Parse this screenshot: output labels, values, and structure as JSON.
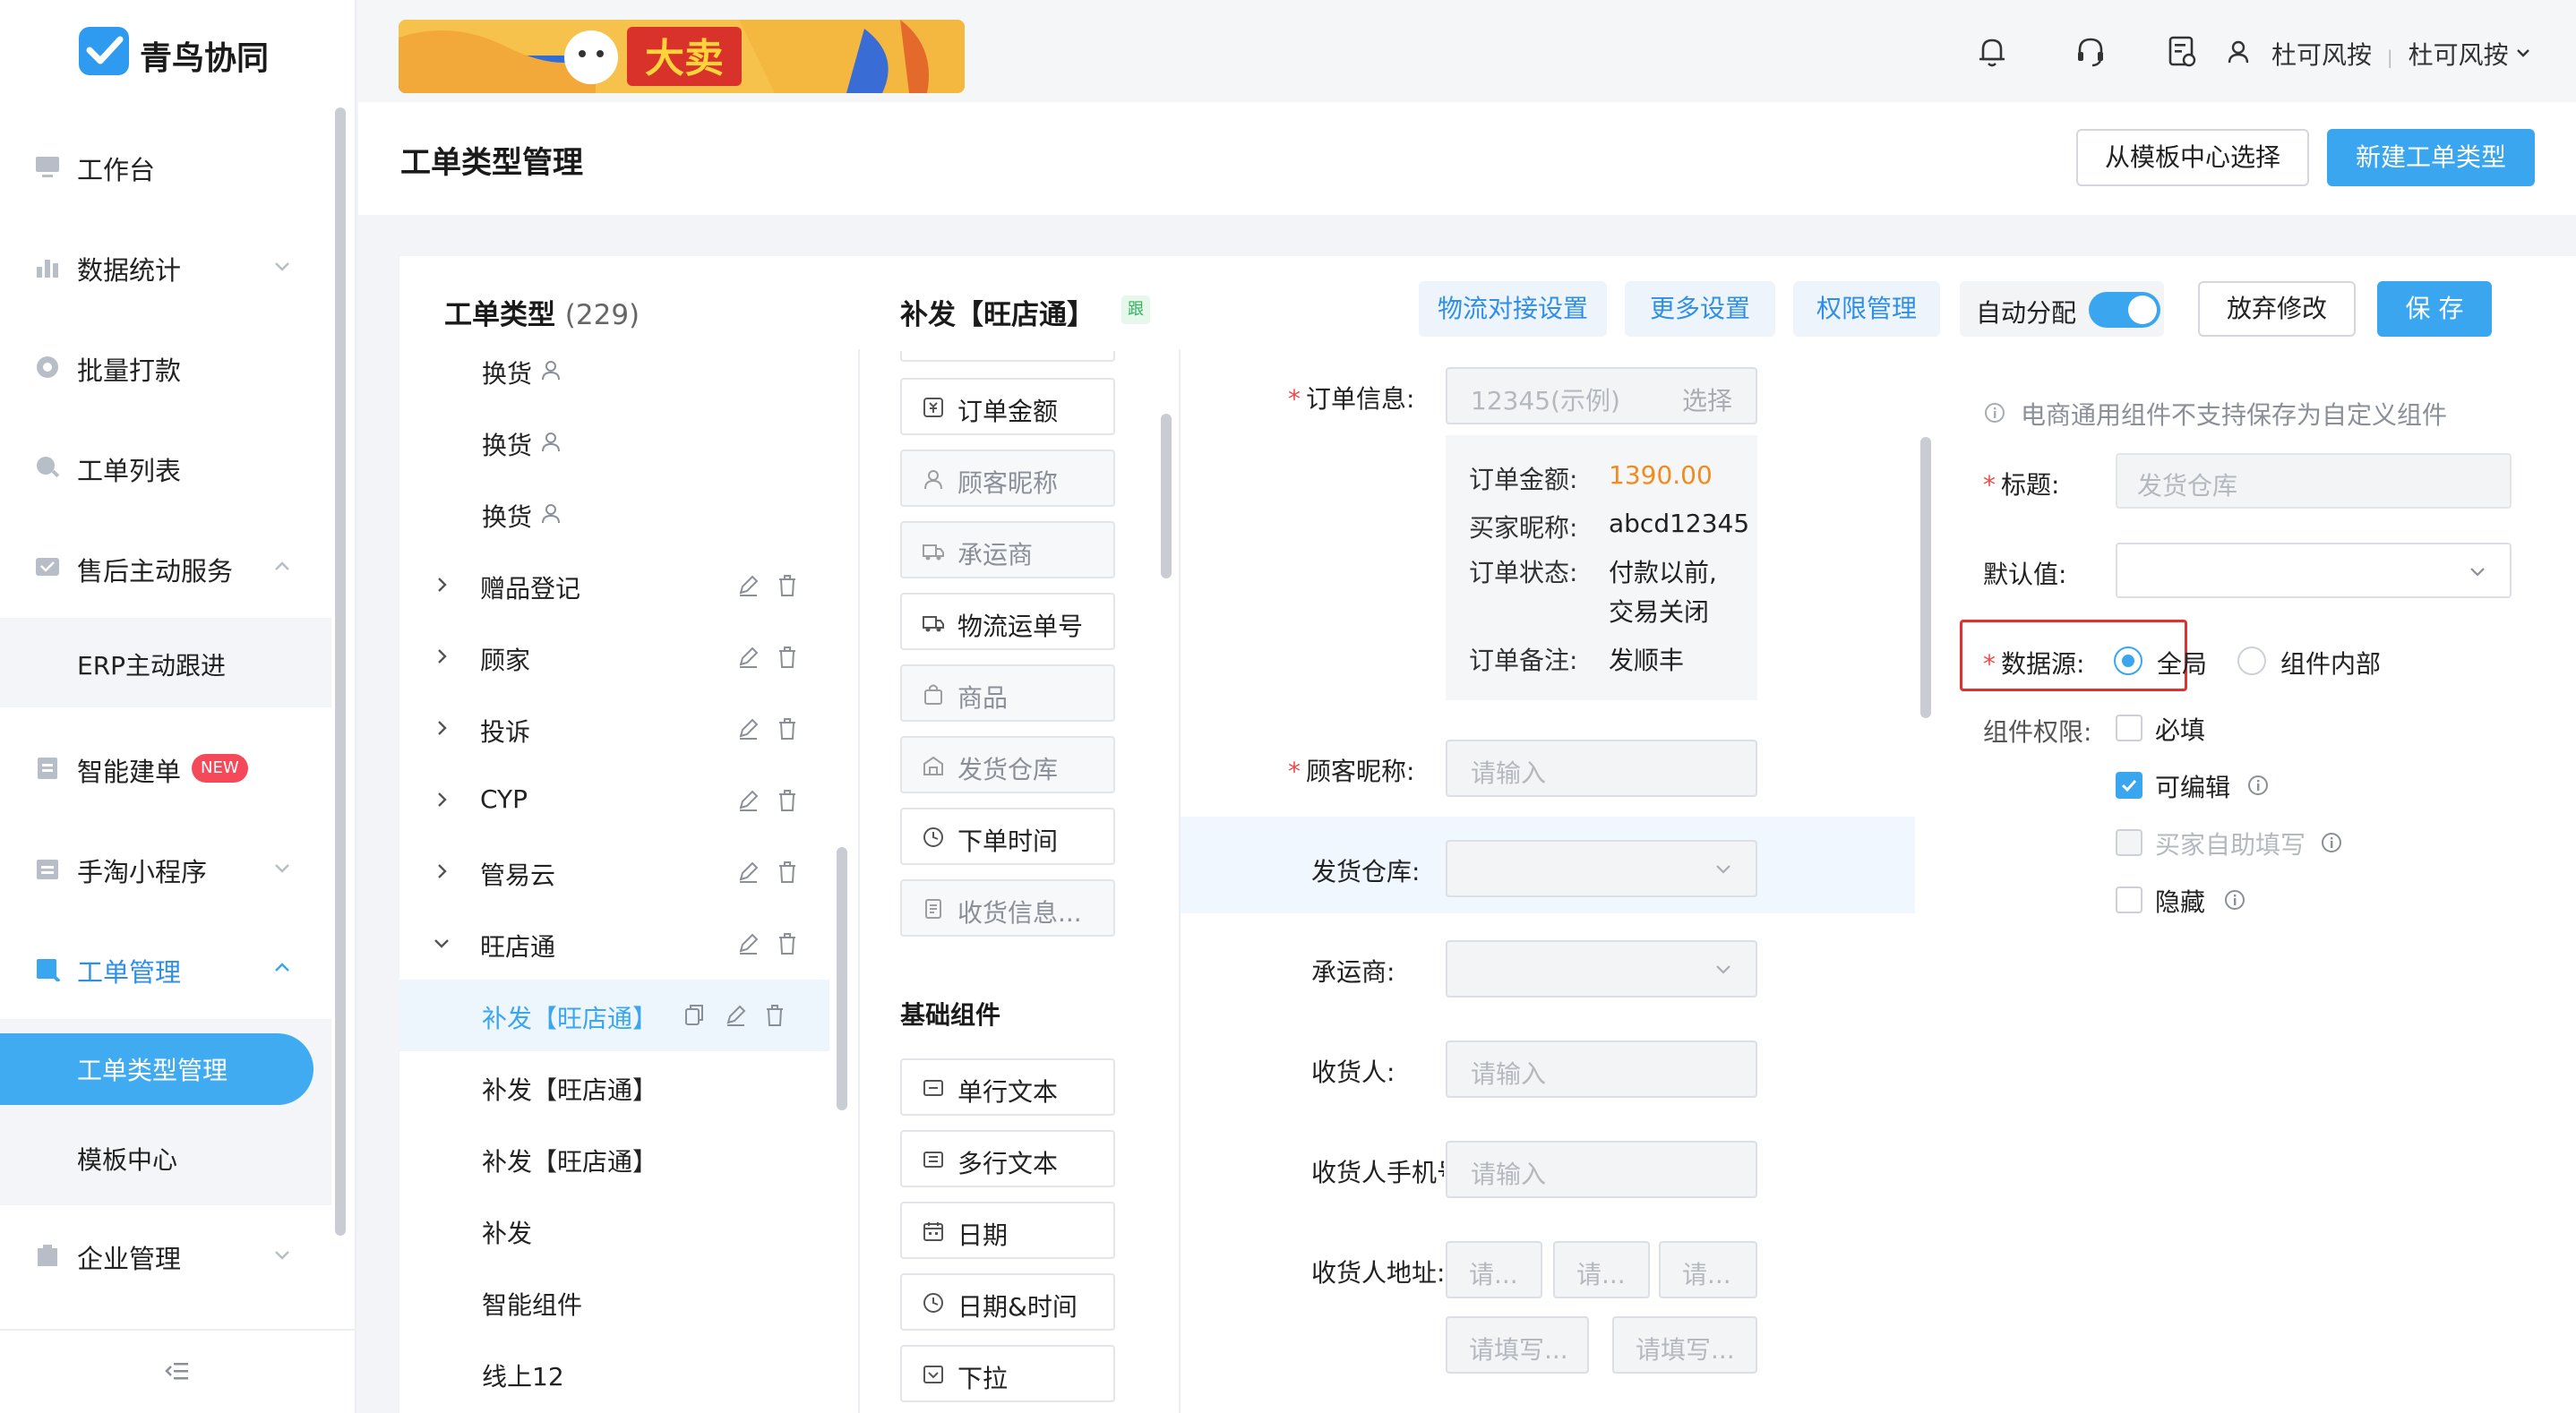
{
  "app": {
    "name": "青鸟协同"
  },
  "sidebar": {
    "items": [
      {
        "label": "工作台"
      },
      {
        "label": "数据统计"
      },
      {
        "label": "批量打款"
      },
      {
        "label": "工单列表"
      },
      {
        "label": "售后主动服务"
      },
      {
        "label": "ERP主动跟进"
      },
      {
        "label": "智能建单",
        "badge": "NEW"
      },
      {
        "label": "手淘小程序"
      },
      {
        "label": "工单管理"
      },
      {
        "label": "工单类型管理"
      },
      {
        "label": "模板中心"
      },
      {
        "label": "企业管理"
      }
    ]
  },
  "topbar": {
    "banner_text": "大卖",
    "user": "杜可风按",
    "org": "杜可风按"
  },
  "header": {
    "title": "工单类型管理",
    "btn_template": "从模板中心选择",
    "btn_new": "新建工单类型"
  },
  "types_panel": {
    "title": "工单类型",
    "count": "(229)",
    "rows": [
      {
        "label": "换货"
      },
      {
        "label": "换货"
      },
      {
        "label": "换货"
      },
      {
        "label": "赠品登记"
      },
      {
        "label": "顾家"
      },
      {
        "label": "投诉"
      },
      {
        "label": "CYP"
      },
      {
        "label": "管易云"
      },
      {
        "label": "旺店通"
      },
      {
        "label": "补发【旺店通】"
      },
      {
        "label": "补发【旺店通】"
      },
      {
        "label": "补发【旺店通】"
      },
      {
        "label": "补发"
      },
      {
        "label": "智能组件"
      },
      {
        "label": "线上12"
      }
    ]
  },
  "editor": {
    "title": "补发【旺店通】",
    "tag": "跟",
    "btn_logistics": "物流对接设置",
    "btn_more": "更多设置",
    "btn_perm": "权限管理",
    "auto_assign": "自动分配",
    "auto_assign_on": true,
    "btn_discard": "放弃修改",
    "btn_save": "保 存"
  },
  "components": {
    "ecom": [
      {
        "label": "订单金额",
        "icon": "money-icon",
        "disabled": false
      },
      {
        "label": "顾客昵称",
        "icon": "user-icon",
        "disabled": true
      },
      {
        "label": "承运商",
        "icon": "truck-icon",
        "disabled": true
      },
      {
        "label": "物流运单号",
        "icon": "truck-icon",
        "disabled": false
      },
      {
        "label": "商品",
        "icon": "bag-icon",
        "disabled": true
      },
      {
        "label": "发货仓库",
        "icon": "warehouse-icon",
        "disabled": true
      },
      {
        "label": "下单时间",
        "icon": "clock-icon",
        "disabled": false
      },
      {
        "label": "收货信息...",
        "icon": "doc-icon",
        "disabled": true
      }
    ],
    "basic_title": "基础组件",
    "basic": [
      {
        "label": "单行文本",
        "icon": "single-line-icon"
      },
      {
        "label": "多行文本",
        "icon": "multi-line-icon"
      },
      {
        "label": "日期",
        "icon": "calendar-icon"
      },
      {
        "label": "日期&时间",
        "icon": "clock-icon"
      },
      {
        "label": "下拉",
        "icon": "select-icon"
      }
    ]
  },
  "form": {
    "order_info": {
      "label": "订单信息:",
      "placeholder": "12345(示例)",
      "select": "选择"
    },
    "order_detail": [
      {
        "k": "订单金额:",
        "v": "1390.00"
      },
      {
        "k": "买家昵称:",
        "v": "abcd12345"
      },
      {
        "k": "订单状态:",
        "v": "付款以前,"
      },
      {
        "k": "",
        "v": "交易关闭"
      },
      {
        "k": "订单备注:",
        "v": "发顺丰"
      }
    ],
    "customer_nick": {
      "label": "顾客昵称:",
      "placeholder": "请输入"
    },
    "warehouse": {
      "label": "发货仓库:"
    },
    "carrier": {
      "label": "承运商:"
    },
    "receiver": {
      "label": "收货人:",
      "placeholder": "请输入"
    },
    "receiver_phone": {
      "label": "收货人手机号",
      "placeholder": "请输入"
    },
    "receiver_addr": {
      "label": "收货人地址:",
      "sel1": "请...",
      "sel2": "请...",
      "sel3": "请...",
      "detail1": "请填写...",
      "detail2": "请填写..."
    }
  },
  "props": {
    "notice": "电商通用组件不支持保存为自定义组件",
    "title_label": "标题:",
    "title_value": "发货仓库",
    "default_label": "默认值:",
    "datasource_label": "数据源:",
    "ds_global": "全局",
    "ds_internal": "组件内部",
    "perm_label": "组件权限:",
    "perm_required": "必填",
    "perm_editable": "可编辑",
    "perm_buyer": "买家自助填写",
    "perm_hidden": "隐藏"
  },
  "colors": {
    "accent": "#3aa6ef",
    "highlight_border": "#e0312f",
    "amount": "#f08c1e"
  }
}
